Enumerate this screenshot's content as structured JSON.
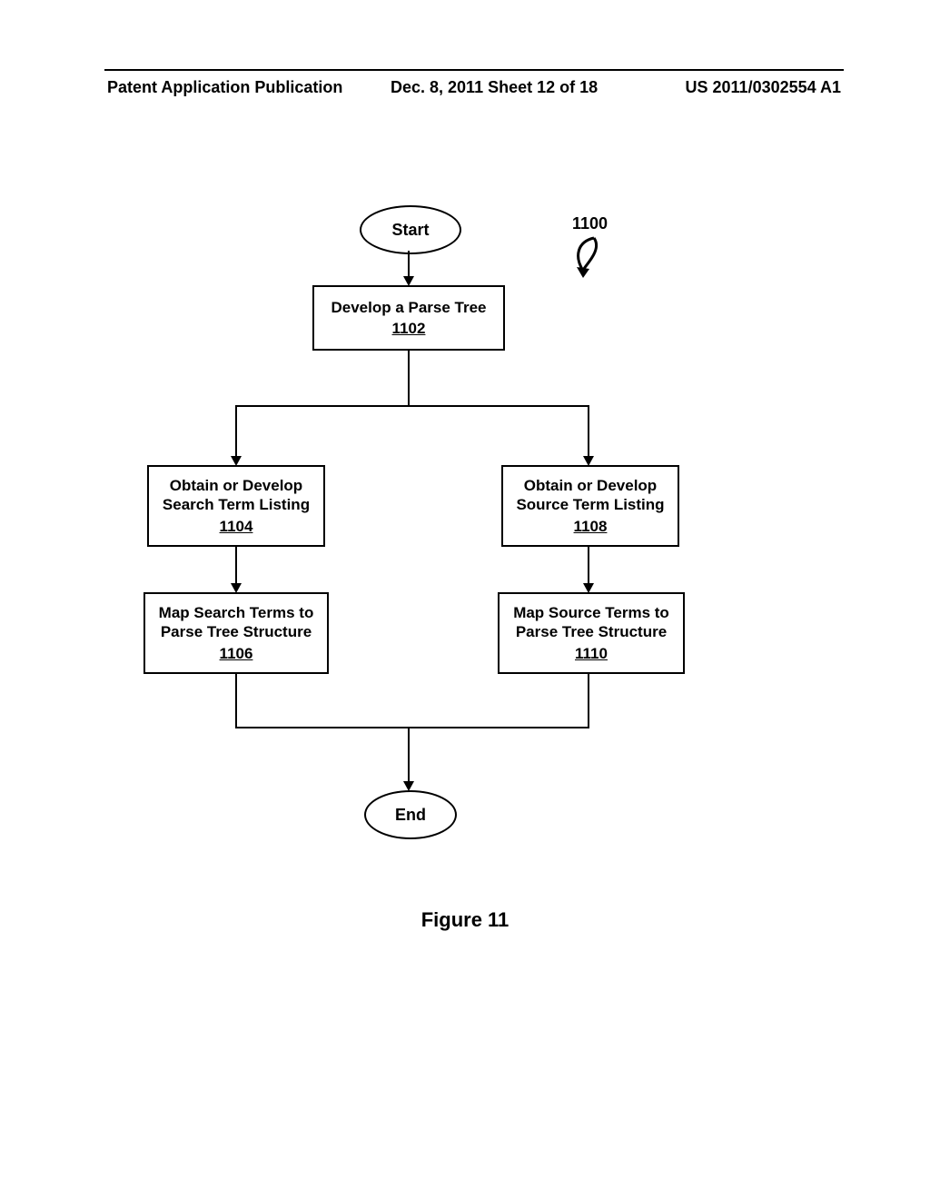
{
  "header": {
    "left": "Patent Application Publication",
    "middle": "Dec. 8, 2011   Sheet 12 of 18",
    "right": "US 2011/0302554 A1"
  },
  "figure_ref": "1100",
  "flow": {
    "start": "Start",
    "n1102": {
      "title": "Develop a Parse Tree",
      "num": "1102"
    },
    "n1104": {
      "title1": "Obtain or Develop",
      "title2": "Search Term Listing",
      "num": "1104"
    },
    "n1106": {
      "title1": "Map Search Terms to",
      "title2": "Parse Tree Structure",
      "num": "1106"
    },
    "n1108": {
      "title1": "Obtain or Develop",
      "title2": "Source Term Listing",
      "num": "1108"
    },
    "n1110": {
      "title1": "Map Source Terms to",
      "title2": "Parse Tree Structure",
      "num": "1110"
    },
    "end": "End"
  },
  "caption": "Figure 11"
}
